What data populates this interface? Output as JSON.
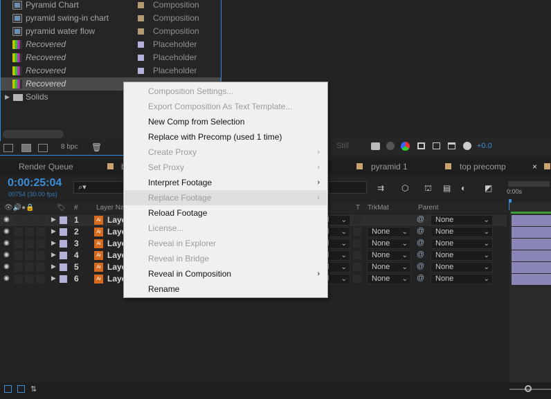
{
  "project": {
    "items": [
      {
        "name": "Pyramid Chart",
        "type": "Composition",
        "kind": "comp",
        "italic": false,
        "swatch": "#b49a72",
        "selected": false
      },
      {
        "name": "pyramid swing-in chart",
        "type": "Composition",
        "kind": "comp",
        "italic": false,
        "swatch": "#b49a72",
        "selected": false
      },
      {
        "name": "pyramid water flow",
        "type": "Composition",
        "kind": "comp",
        "italic": false,
        "swatch": "#b49a72",
        "selected": false
      },
      {
        "name": "Recovered",
        "type": "Placeholder",
        "kind": "placeholder",
        "italic": true,
        "swatch": "#b3b0d9",
        "selected": false
      },
      {
        "name": "Recovered",
        "type": "Placeholder",
        "kind": "placeholder",
        "italic": true,
        "swatch": "#b3b0d9",
        "selected": false
      },
      {
        "name": "Recovered",
        "type": "Placeholder",
        "kind": "placeholder",
        "italic": true,
        "swatch": "#b3b0d9",
        "selected": false
      },
      {
        "name": "Recovered",
        "type": "",
        "kind": "placeholder",
        "italic": true,
        "swatch": "",
        "selected": true
      }
    ],
    "folder": {
      "name": "Solids"
    },
    "footer": {
      "bpc": "8 bpc"
    }
  },
  "viewer_toolbar": {
    "still": "Still",
    "exposure": "+0.0"
  },
  "tabs": {
    "render_queue": "Render Queue",
    "tab2": "b",
    "pyramid": "pyramid 1",
    "top_precomp": "top precomp",
    "close": "×",
    "colors": {
      "tab_square": "#c9a36d"
    }
  },
  "timeline": {
    "timecode": "0:00:25:04",
    "frames": "00754 (30.00 fps)",
    "headers": {
      "layer_name": "Layer Name",
      "num": "#",
      "t": "T",
      "trkmat": "TrkMat",
      "parent": "Parent"
    },
    "ruler": "0:00s",
    "layers": [
      {
        "num": "1",
        "name": "Laye",
        "mode": "al",
        "trkmat": "",
        "parent": "None",
        "selected": true
      },
      {
        "num": "2",
        "name": "Laye",
        "mode": "al",
        "trkmat": "None",
        "parent": "None",
        "selected": false
      },
      {
        "num": "3",
        "name": "Laye",
        "mode": "al",
        "trkmat": "None",
        "parent": "None",
        "selected": false
      },
      {
        "num": "4",
        "name": "Laye",
        "mode": "al",
        "trkmat": "None",
        "parent": "None",
        "selected": false
      },
      {
        "num": "5",
        "name": "Laye",
        "mode": "al",
        "trkmat": "None",
        "parent": "None",
        "selected": false
      },
      {
        "num": "6",
        "name": "Laye",
        "mode": "al",
        "trkmat": "None",
        "parent": "None",
        "selected": false
      }
    ]
  },
  "context_menu": {
    "items": [
      {
        "label": "Composition Settings...",
        "enabled": false,
        "submenu": false
      },
      {
        "label": "Export Composition As Text Template...",
        "enabled": false,
        "submenu": false
      },
      {
        "label": "New Comp from Selection",
        "enabled": true,
        "submenu": false
      },
      {
        "label": "Replace with Precomp (used 1 time)",
        "enabled": true,
        "submenu": false
      },
      {
        "label": "Create Proxy",
        "enabled": false,
        "submenu": true
      },
      {
        "label": "Set Proxy",
        "enabled": false,
        "submenu": true
      },
      {
        "label": "Interpret Footage",
        "enabled": true,
        "submenu": true
      },
      {
        "label": "Replace Footage",
        "enabled": false,
        "submenu": true,
        "hover": true
      },
      {
        "label": "Reload Footage",
        "enabled": true,
        "submenu": false
      },
      {
        "label": "License...",
        "enabled": false,
        "submenu": false
      },
      {
        "label": "Reveal in Explorer",
        "enabled": false,
        "submenu": false
      },
      {
        "label": "Reveal in Bridge",
        "enabled": false,
        "submenu": false
      },
      {
        "label": "Reveal in Composition",
        "enabled": true,
        "submenu": true
      },
      {
        "label": "Rename",
        "enabled": true,
        "submenu": false
      }
    ]
  },
  "colors": {
    "accent": "#3b8ed8",
    "label_lavender": "#b3b0d9",
    "menu_bg": "#f0f0f0"
  }
}
